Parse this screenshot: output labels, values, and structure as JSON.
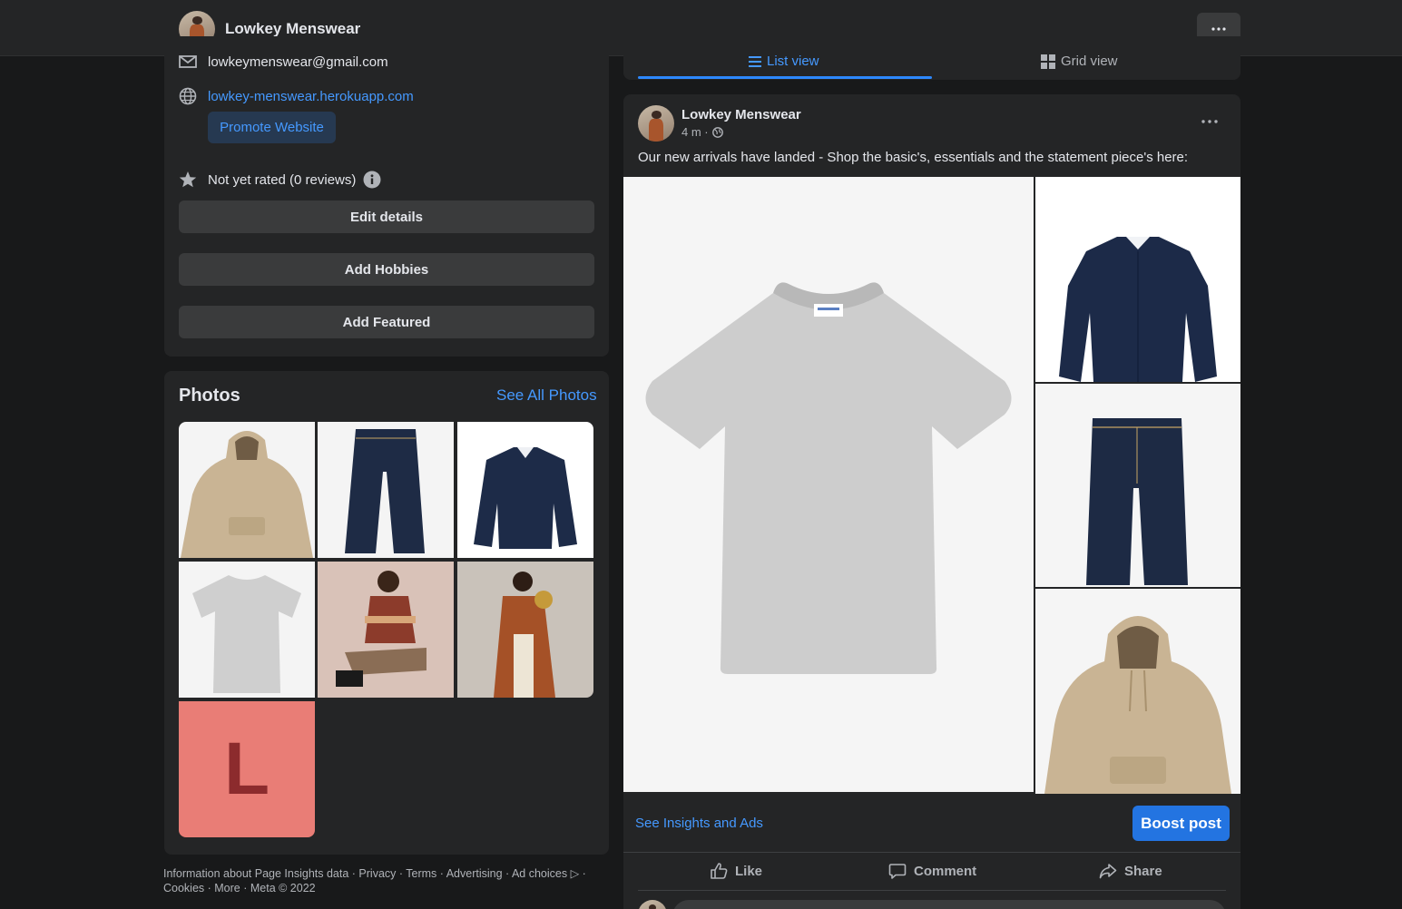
{
  "page": {
    "name": "Lowkey Menswear"
  },
  "intro": {
    "email": "lowkeymenswear@gmail.com",
    "website": "lowkey-menswear.herokuapp.com",
    "promote_label": "Promote Website",
    "rating": "Not yet rated (0 reviews)",
    "edit_label": "Edit details",
    "hobbies_label": "Add Hobbies",
    "featured_label": "Add Featured"
  },
  "photos": {
    "title": "Photos",
    "see_all": "See All Photos",
    "placeholder_letter": "L"
  },
  "footer": {
    "line1": "Information about Page Insights data · Privacy · Terms · Advertising · Ad choices ▷ ·",
    "line2": "Cookies · More · Meta © 2022"
  },
  "tabs": {
    "list_view": "List view",
    "grid_view": "Grid view"
  },
  "post": {
    "author": "Lowkey Menswear",
    "time": "4 m ·",
    "text": "Our new arrivals have landed - Shop the basic's, essentials and the statement piece's here:",
    "insights_label": "See Insights and Ads",
    "boost_label": "Boost post",
    "like_label": "Like",
    "comment_label": "Comment",
    "share_label": "Share"
  },
  "colors": {
    "accent": "#2374e1",
    "link": "#4599ff",
    "background": "#18191a",
    "card": "#242526",
    "placeholder_tile": "#e97d76"
  }
}
